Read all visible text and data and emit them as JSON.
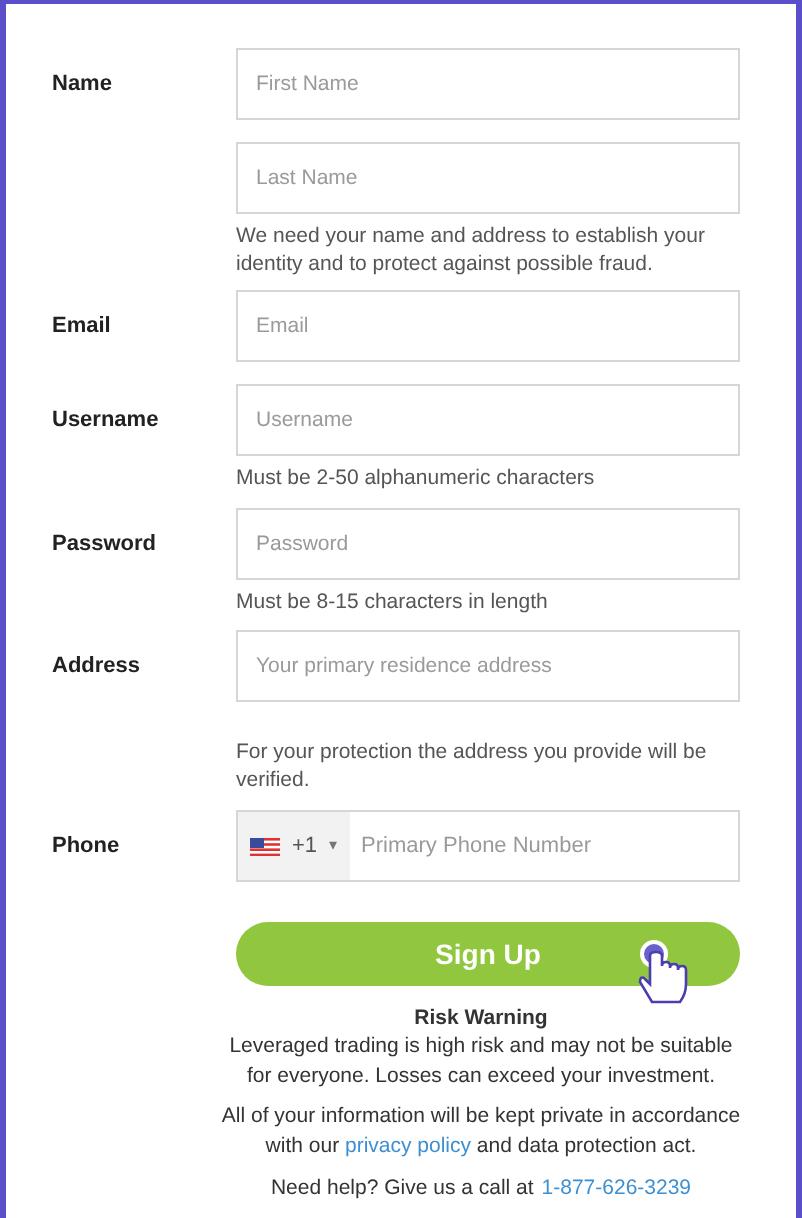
{
  "rows": [
    {
      "label": "Name",
      "kind": "text",
      "placeholder": "First Name"
    },
    {
      "kind": "text",
      "placeholder": "Last Name",
      "help": "We need your name and address to establish your identity and to protect against possible fraud."
    },
    {
      "label": "Email",
      "kind": "text",
      "placeholder": "Email"
    },
    {
      "label": "Username",
      "kind": "text",
      "placeholder": "Username",
      "help": "Must be 2-50 alphanumeric characters"
    },
    {
      "label": "Password",
      "kind": "text",
      "placeholder": "Password",
      "help": "Must be 8-15 characters in length"
    },
    {
      "label": "Address",
      "kind": "text",
      "placeholder": "Your primary residence address",
      "help": "For your protection the address you provide will be verified."
    },
    {
      "label": "Phone",
      "kind": "phone",
      "code": "+1",
      "caret": "▾",
      "placeholder": "Primary Phone Number"
    }
  ],
  "submit": "Sign Up",
  "risk_title": "Risk Warning",
  "risk_text": "Leveraged trading is high risk and may not be suitable for everyone. Losses can exceed your investment.",
  "privacy": {
    "before": "All of your information will be kept private in accordance with our",
    "link": "privacy policy",
    "after": "and data protection act."
  },
  "help": {
    "text": "Need help? Give us a call at",
    "phone": "1-877-626-3239"
  }
}
